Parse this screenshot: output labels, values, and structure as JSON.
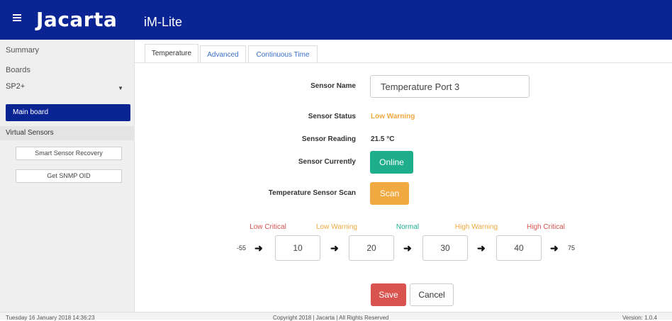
{
  "header": {
    "menu_icon": "hamburger-icon",
    "brand": "Jacarta",
    "product": "iM-Lite",
    "bg_color": "#0b2494"
  },
  "sidebar": {
    "summary": "Summary",
    "boards": "Boards",
    "board_select": "SP2+",
    "main_board": "Main board",
    "virtual_sensors": "Virtual Sensors",
    "smart_sensor_recovery": "Smart Sensor Recovery",
    "get_snmp_oid": "Get SNMP OID"
  },
  "tabs": [
    "Temperature",
    "Advanced",
    "Continuous Time"
  ],
  "form": {
    "sensor_name_label": "Sensor Name",
    "sensor_name_value": "Temperature Port 3",
    "sensor_status_label": "Sensor Status",
    "sensor_status_value": "Low Warning",
    "sensor_reading_label": "Sensor Reading",
    "sensor_reading_value": "21.5 °C",
    "sensor_currently_label": "Sensor Currently",
    "online_button": "Online",
    "scan_label": "Temperature Sensor Scan",
    "scan_button": "Scan"
  },
  "thresholds": {
    "labels": [
      "Low Critical",
      "Low Warning",
      "Normal",
      "High Warning",
      "High Critical"
    ],
    "colors": {
      "critical": "#d9534f",
      "warning": "#f1a942",
      "normal": "#1fae8c"
    },
    "min": "-55",
    "values": [
      "10",
      "20",
      "30",
      "40"
    ],
    "max": "75"
  },
  "actions": {
    "save": "Save",
    "cancel": "Cancel"
  },
  "footer": {
    "datetime": "Tuesday 16 January 2018 14:36:23",
    "copyright": "Copyright 2018 | Jacarta | All Rights Reserved",
    "version": "Version: 1.0.4"
  }
}
